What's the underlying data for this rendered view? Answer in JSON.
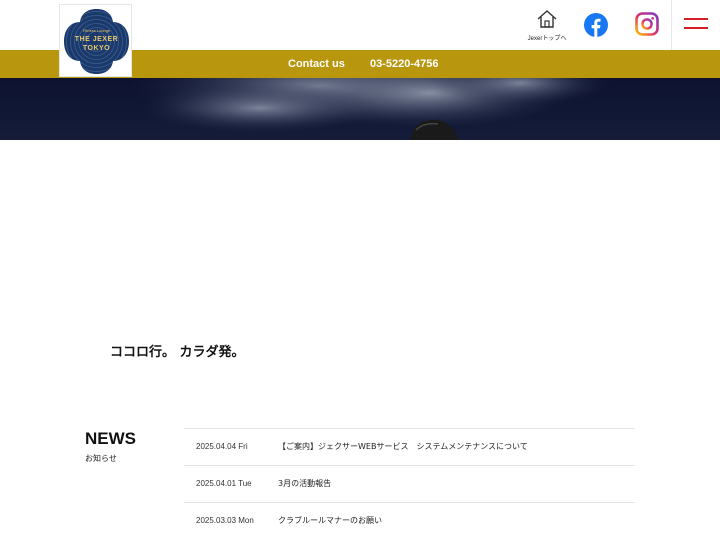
{
  "header": {
    "logo": {
      "line1": "Fitness Lounge",
      "line2": "THE JEXER",
      "line3": "TOKYO",
      "color": "#1b3a6b"
    },
    "home_label": "Jexerトップへ",
    "icons": {
      "home": "home-icon",
      "facebook": "facebook-icon",
      "instagram": "instagram-icon",
      "menu": "hamburger-menu-icon"
    }
  },
  "contact_bar": {
    "contact_label": "Contact us",
    "phone": "03-5220-4756",
    "color": "#b8960d"
  },
  "tagline": "ココロ行。 カラダ発。",
  "news": {
    "title": "NEWS",
    "subtitle": "お知らせ",
    "items": [
      {
        "date": "2025.04.04 Fri",
        "text": "【ご案内】ジェクサーWEBサービス　システムメンテナンスについて"
      },
      {
        "date": "2025.04.01 Tue",
        "text": "3月の活動報告"
      },
      {
        "date": "2025.03.03 Mon",
        "text": "クラブルールマナーのお願い"
      }
    ]
  }
}
